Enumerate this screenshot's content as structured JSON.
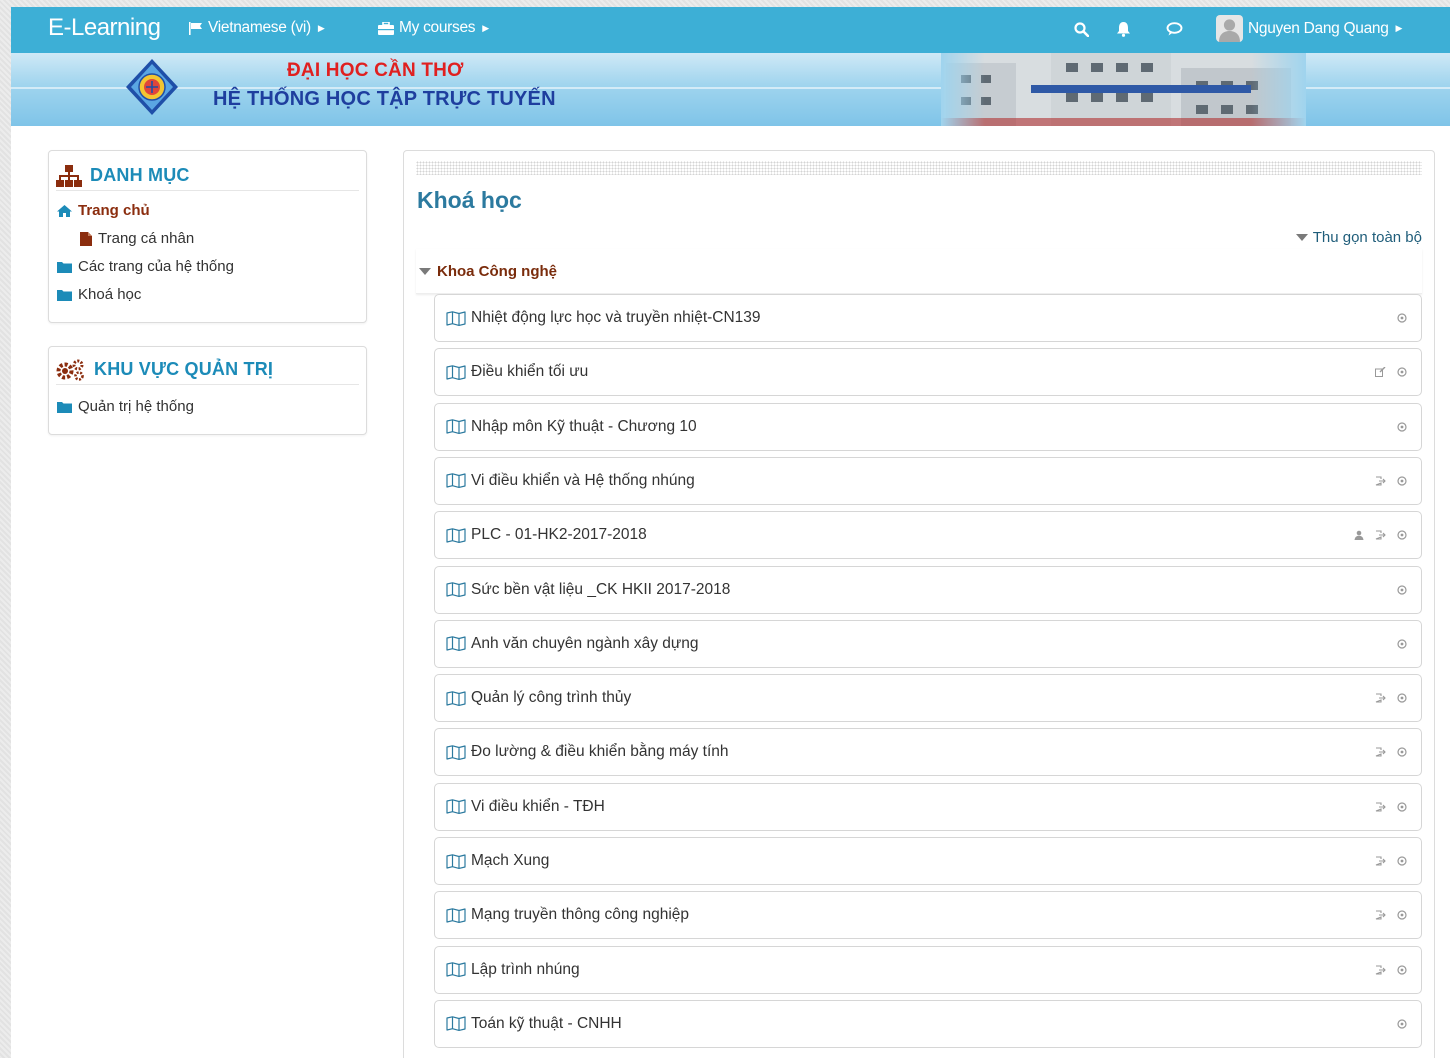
{
  "navbar": {
    "brand": "E-Learning",
    "language": "Vietnamese (vi)",
    "my_courses": "My courses",
    "user_name": "Nguyen Dang Quang",
    "icons": [
      "search-icon",
      "bell-icon",
      "chat-icon"
    ]
  },
  "banner": {
    "line1": "ĐẠI HỌC CẦN THƠ",
    "line2": "HỆ THỐNG HỌC TẬP TRỰC TUYẾN"
  },
  "nav_block": {
    "title": "DANH MỤC",
    "home": "Trang chủ",
    "profile": "Trang cá nhân",
    "site_pages": "Các trang của hệ thống",
    "courses": "Khoá học"
  },
  "admin_block": {
    "title": "KHU VỰC QUẢN TRỊ",
    "site_admin": "Quản trị hệ thống"
  },
  "main": {
    "title": "Khoá học",
    "collapse_all": "Thu gọn toàn bộ",
    "category": "Khoa Công nghệ",
    "courses": [
      {
        "name": "Nhiệt động lực học và truyền nhiệt-CN139",
        "icons": [
          "info"
        ]
      },
      {
        "name": "Điều khiển tối ưu",
        "icons": [
          "edit",
          "info"
        ]
      },
      {
        "name": "Nhập môn Kỹ thuật - Chương 10",
        "icons": [
          "info"
        ]
      },
      {
        "name": "Vi điều khiển và Hệ thống nhúng",
        "icons": [
          "enrol",
          "info"
        ]
      },
      {
        "name": "PLC - 01-HK2-2017-2018",
        "icons": [
          "guest",
          "enrol",
          "info"
        ]
      },
      {
        "name": "Sức bền vật liệu _CK HKII 2017-2018",
        "icons": [
          "info"
        ]
      },
      {
        "name": "Anh văn chuyên ngành xây dựng",
        "icons": [
          "info"
        ]
      },
      {
        "name": "Quản lý công trình thủy",
        "icons": [
          "enrol",
          "info"
        ]
      },
      {
        "name": "Đo lường & điều khiển bằng máy tính",
        "icons": [
          "enrol",
          "info"
        ]
      },
      {
        "name": "Vi điều khiển - TĐH",
        "icons": [
          "enrol",
          "info"
        ]
      },
      {
        "name": "Mạch Xung",
        "icons": [
          "enrol",
          "info"
        ]
      },
      {
        "name": "Mạng truyền thông công nghiệp",
        "icons": [
          "enrol",
          "info"
        ]
      },
      {
        "name": "Lập trình nhúng",
        "icons": [
          "enrol",
          "info"
        ]
      },
      {
        "name": "Toán kỹ thuật - CNHH",
        "icons": [
          "info"
        ]
      }
    ]
  },
  "colors": {
    "navbar": "#3dafd6",
    "block_title": "#1c8bb8",
    "main_title": "#2c7a9f",
    "category": "#7a2c0c",
    "banner_red": "#e02020",
    "banner_blue": "#1e3e9e"
  }
}
